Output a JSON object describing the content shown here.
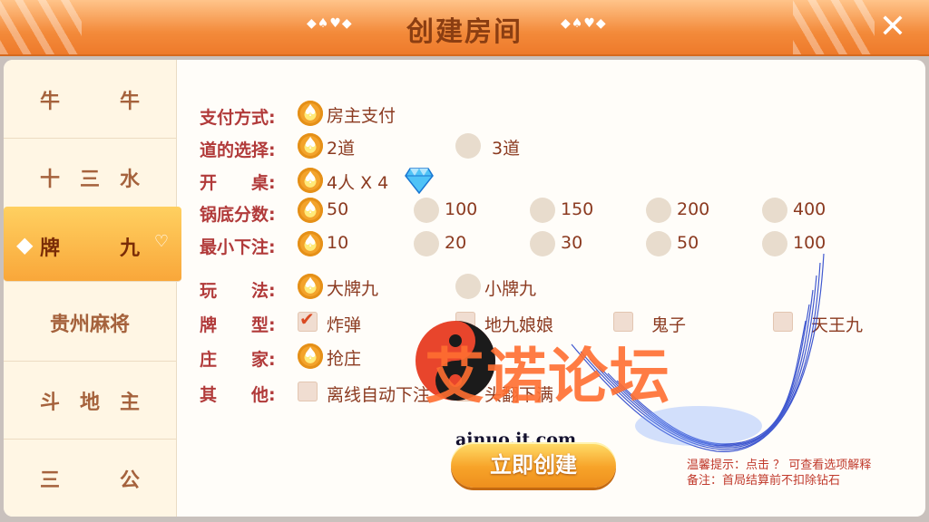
{
  "header": {
    "title": "创建房间",
    "deco_left": "◆♠♥◆",
    "deco_right": "◆♠♥◆",
    "close_icon": "✕"
  },
  "sidebar": {
    "items": [
      {
        "label": "牛　　　牛"
      },
      {
        "label": "十　三　水"
      },
      {
        "label": "牌　　　九"
      },
      {
        "label": "贵州麻将"
      },
      {
        "label": "斗　地　主"
      },
      {
        "label": "三　　　公"
      }
    ],
    "active_index": 2
  },
  "rows": {
    "pay": {
      "label": "支付方式:",
      "options": [
        "房主支付"
      ]
    },
    "dao": {
      "label": "道的选择:",
      "options": [
        "2道",
        "3道"
      ]
    },
    "table": {
      "label": "开　　桌:",
      "options": [
        "4人 X 4"
      ]
    },
    "pot": {
      "label": "锅底分数:",
      "options": [
        "50",
        "100",
        "150",
        "200",
        "400"
      ]
    },
    "minbet": {
      "label": "最小下注:",
      "options": [
        "10",
        "20",
        "30",
        "50",
        "100"
      ]
    },
    "play": {
      "label": "玩　　法:",
      "options": [
        "大牌九",
        "小牌九"
      ]
    },
    "cards": {
      "label": "牌　　型:",
      "options": [
        "炸弹",
        "地九娘娘",
        "鬼子",
        "天王九"
      ]
    },
    "banker": {
      "label": "庄　　家:",
      "options": [
        "抢庄"
      ]
    },
    "other": {
      "label": "其　　他:",
      "options": [
        "离线自动下注",
        "头翻下满"
      ]
    }
  },
  "create_button": "立即创建",
  "notes": {
    "line1": "温馨提示：点击 ？  可查看选项解释",
    "line2": "备注：首局结算前不扣除钻石"
  },
  "watermark": {
    "text": "艾诺论坛",
    "url": "ainuo.it.com"
  },
  "colors": {
    "accent": "#f39a2d",
    "label_red": "#b13a3a",
    "option_text": "#8b3a20"
  }
}
